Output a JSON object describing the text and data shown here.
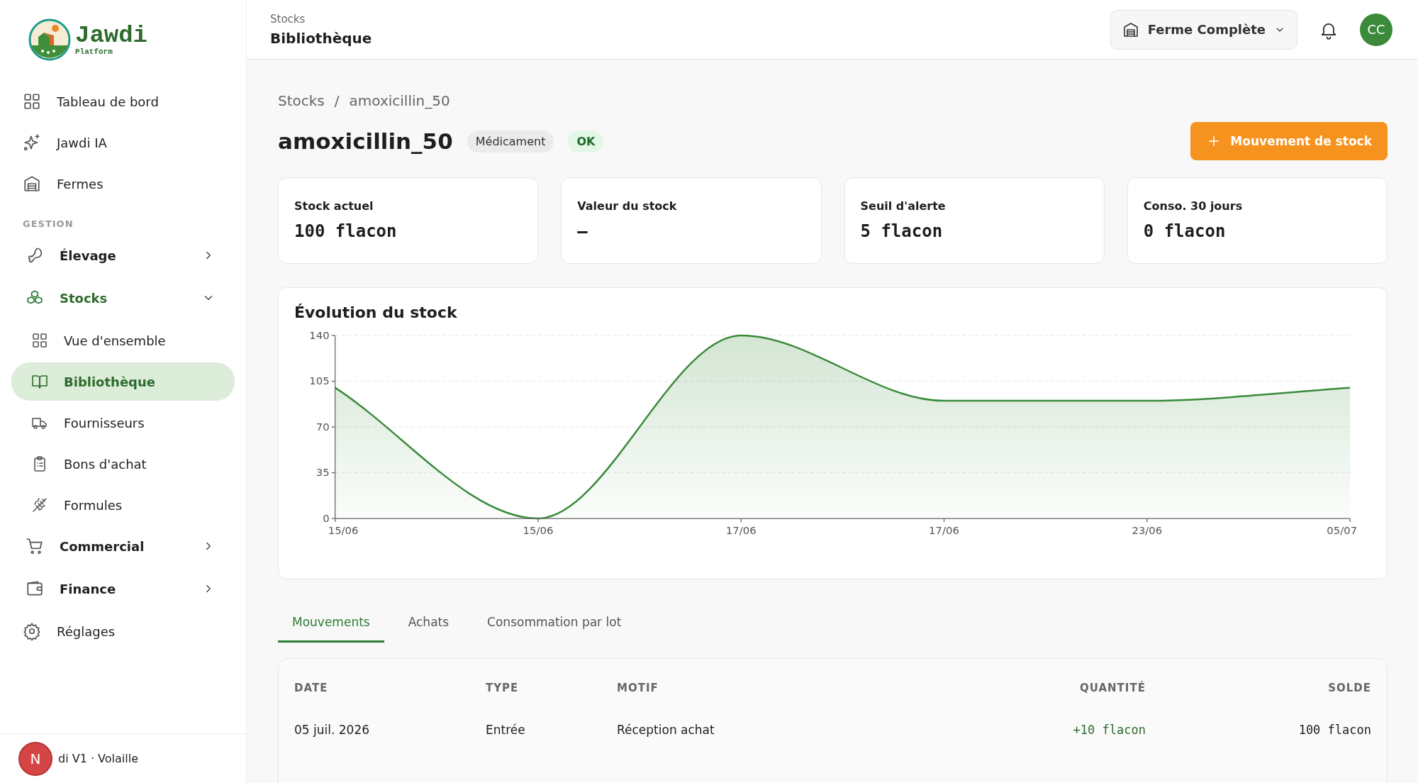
{
  "logo": {
    "name": "Jawdi",
    "subtitle": "Platform"
  },
  "sidebar": {
    "items": [
      {
        "kind": "link",
        "label": "Tableau de bord",
        "selected": false
      },
      {
        "kind": "link",
        "label": "Jawdi IA",
        "selected": false
      },
      {
        "kind": "link",
        "label": "Fermes",
        "selected": false
      },
      {
        "kind": "section",
        "label": "GESTION"
      },
      {
        "kind": "group",
        "label": "Élevage",
        "expanded": false,
        "selected": false
      },
      {
        "kind": "group",
        "label": "Stocks",
        "expanded": true,
        "selected": false,
        "children": [
          {
            "label": "Vue d'ensemble",
            "selected": false
          },
          {
            "label": "Bibliothèque",
            "selected": true
          },
          {
            "label": "Fournisseurs",
            "selected": false
          },
          {
            "label": "Bons d'achat",
            "selected": false
          },
          {
            "label": "Formules",
            "selected": false
          }
        ]
      },
      {
        "kind": "group",
        "label": "Commercial",
        "expanded": false,
        "selected": false
      },
      {
        "kind": "group",
        "label": "Finance",
        "expanded": false,
        "selected": false
      },
      {
        "kind": "link",
        "label": "Réglages",
        "selected": false
      }
    ],
    "footer": {
      "badge": "N",
      "text": "di V1 · Volaille"
    }
  },
  "header": {
    "breadcrumb": "Stocks",
    "title": "Bibliothèque",
    "farm_selector": "Ferme Complète",
    "avatar": "CC"
  },
  "page": {
    "breadcrumb": [
      "Stocks",
      "amoxicillin_50"
    ],
    "separator": "/",
    "title": "amoxicillin_50",
    "tags": [
      {
        "kind": "category",
        "label": "Médicament"
      },
      {
        "kind": "status",
        "label": "OK"
      }
    ],
    "action": "Mouvement de stock"
  },
  "stats": [
    {
      "label": "Stock actuel",
      "value": "100 flacon"
    },
    {
      "label": "Valeur du stock",
      "value": "—"
    },
    {
      "label": "Seuil d'alerte",
      "value": "5 flacon"
    },
    {
      "label": "Conso. 30 jours",
      "value": "0 flacon"
    }
  ],
  "chart": {
    "title": "Évolution du stock",
    "chart_data": {
      "type": "area",
      "categories": [
        "15/06",
        "15/06",
        "17/06",
        "17/06",
        "23/06",
        "05/07"
      ],
      "series": [
        {
          "color": "#3a8a3a",
          "values": [
            100,
            0,
            140,
            90,
            90,
            100
          ]
        }
      ],
      "ylim": [
        0,
        140
      ],
      "yticks": [
        0,
        35,
        70,
        105,
        140
      ],
      "grid": true
    }
  },
  "tabs": [
    {
      "label": "Mouvements",
      "selected": true
    },
    {
      "label": "Achats",
      "selected": false
    },
    {
      "label": "Consommation par lot",
      "selected": false
    }
  ],
  "table": {
    "columns": [
      {
        "label": "DATE",
        "kind": "text"
      },
      {
        "label": "TYPE",
        "kind": "text"
      },
      {
        "label": "MOTIF",
        "kind": "text"
      },
      {
        "label": "QUANTITÉ",
        "kind": "quantity"
      },
      {
        "label": "SOLDE",
        "kind": "balance"
      }
    ],
    "rows": [
      {
        "cells": [
          "05 juil. 2026",
          "Entrée",
          "Réception achat",
          "+10 flacon",
          "100 flacon"
        ]
      }
    ]
  }
}
